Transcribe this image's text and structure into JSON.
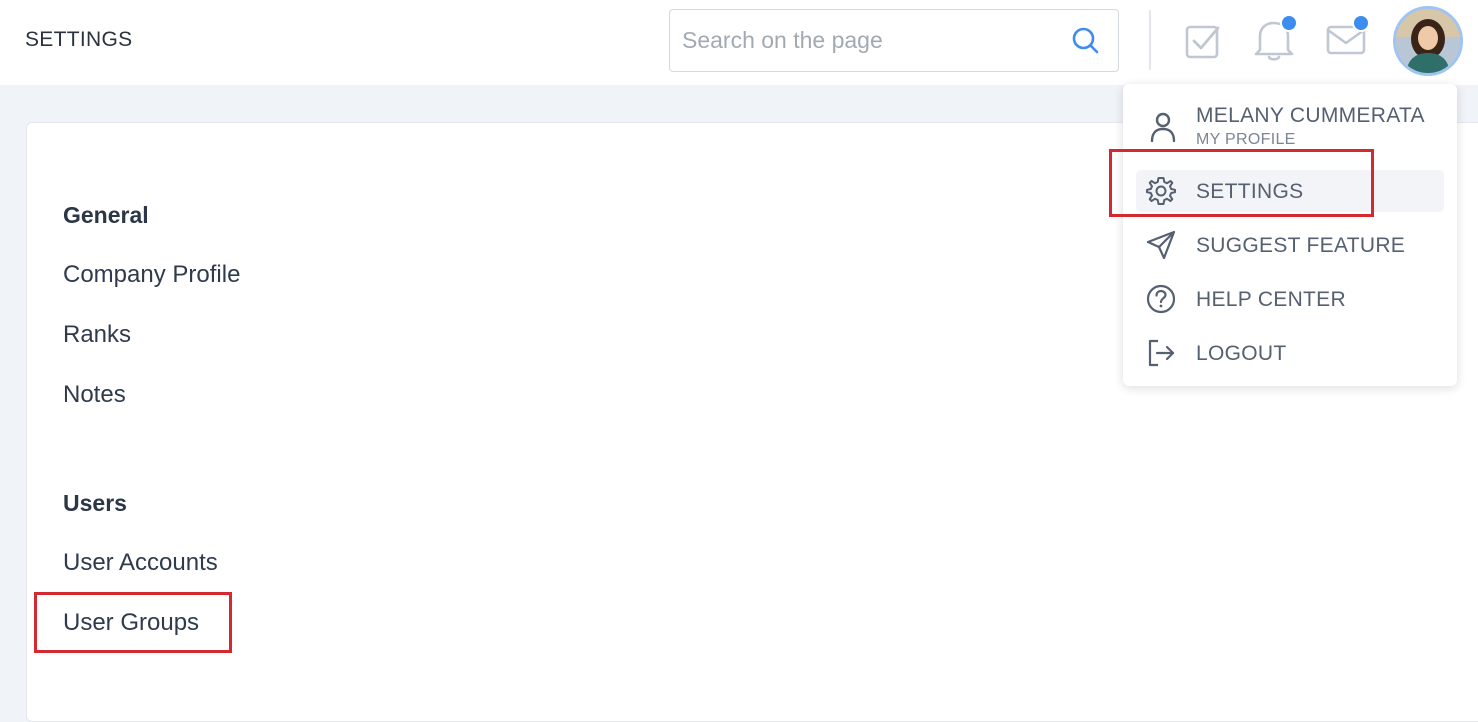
{
  "header": {
    "title": "SETTINGS",
    "search_placeholder": "Search on the page",
    "search_icon": "search-icon",
    "icons": [
      "tasks-check-icon",
      "bell-icon",
      "mail-icon"
    ],
    "notification_dot_color": "#3d8cf0"
  },
  "sidebar": {
    "sections": [
      {
        "heading": "General",
        "items": [
          "Company Profile",
          "Ranks",
          "Notes"
        ]
      },
      {
        "heading": "Users",
        "items": [
          "User Accounts",
          "User Groups"
        ]
      }
    ]
  },
  "user_menu": {
    "name": "MELANY CUMMERATA",
    "subtitle": "MY PROFILE",
    "items": [
      {
        "label": "SETTINGS",
        "icon": "gear-icon",
        "active": true
      },
      {
        "label": "SUGGEST FEATURE",
        "icon": "send-icon"
      },
      {
        "label": "HELP CENTER",
        "icon": "help-circle-icon"
      },
      {
        "label": "LOGOUT",
        "icon": "logout-icon"
      }
    ]
  },
  "colors": {
    "highlight": "#d42a2f",
    "accent": "#3d8cf0"
  }
}
